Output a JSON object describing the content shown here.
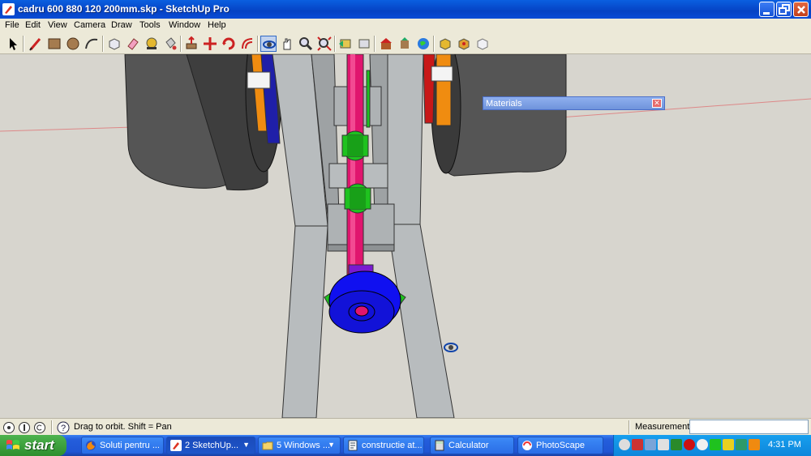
{
  "window": {
    "title": "cadru 600 880 120 200mm.skp - SketchUp Pro"
  },
  "menu": [
    "File",
    "Edit",
    "View",
    "Camera",
    "Draw",
    "Tools",
    "Window",
    "Help"
  ],
  "toolbar": {
    "tools": [
      "select-icon",
      "line-icon",
      "rectangle-icon",
      "circle-icon",
      "arc-icon",
      "make-component-icon",
      "eraser-icon",
      "tape-measure-icon",
      "paint-bucket-icon",
      "push-pull-icon",
      "move-icon",
      "rotate-icon",
      "offset-icon",
      "orbit-icon",
      "pan-icon",
      "zoom-icon",
      "zoom-extents-icon",
      "previous-view-icon",
      "next-view-icon",
      "warehouse-icon",
      "share-model-icon",
      "google-earth-icon",
      "component-icon",
      "extension-icon",
      "send-layout-icon"
    ],
    "active_tool": "orbit-icon"
  },
  "materials_panel": {
    "title": "Materials"
  },
  "status": {
    "hint": "Drag to orbit.  Shift = Pan",
    "measurements_label": "Measurements",
    "measurements_value": ""
  },
  "taskbar": {
    "start_label": "start",
    "tasks": [
      {
        "label": "Soluti pentru ...",
        "icon": "firefox-icon"
      },
      {
        "label": "2 SketchUp...",
        "icon": "sketchup-icon",
        "active": true
      },
      {
        "label": "5 Windows ...",
        "icon": "folder-icon"
      },
      {
        "label": "constructie at...",
        "icon": "document-icon"
      },
      {
        "label": "Calculator",
        "icon": "calculator-icon"
      },
      {
        "label": "PhotoScape",
        "icon": "photoscape-icon"
      }
    ],
    "clock": "4:31 PM"
  },
  "colors": {
    "shaft": "#e0156e",
    "bearing": "#1fc21f",
    "pulley": "#1010f0",
    "frame": "#b8bcbe",
    "wheel": "#4a4a4a"
  }
}
